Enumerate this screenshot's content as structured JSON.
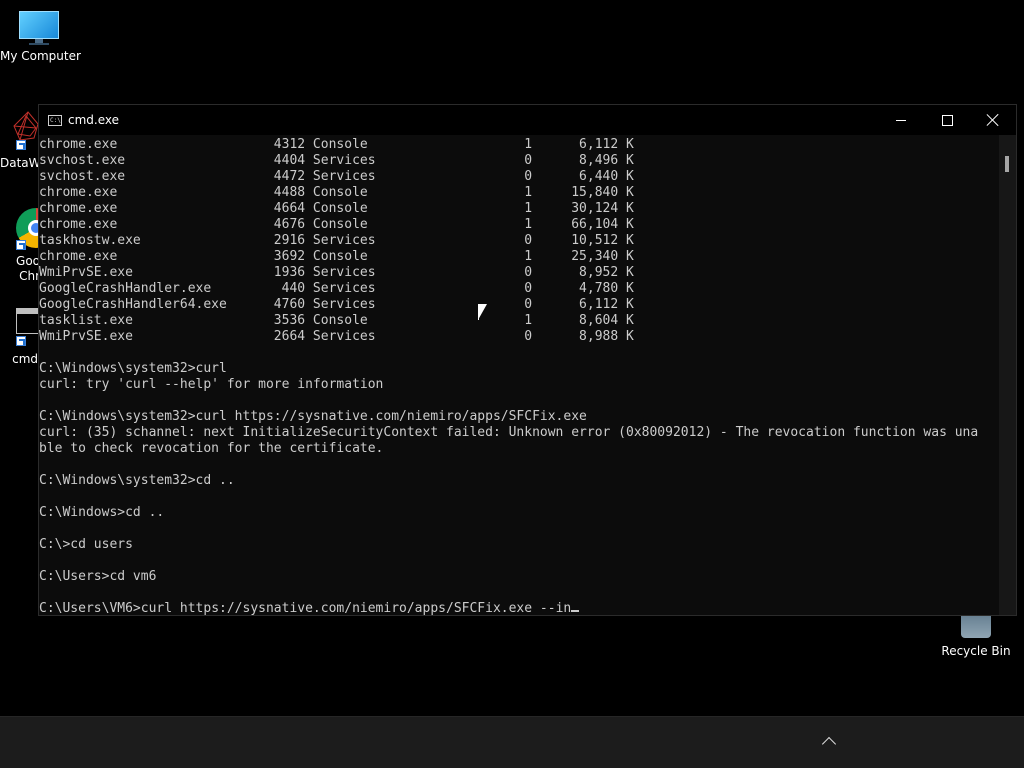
{
  "desktop": {
    "icons": [
      {
        "label": "My Computer",
        "icon": "monitor-icon"
      },
      {
        "label": "DataW",
        "icon": "datawrapper-shortcut-icon"
      },
      {
        "label": "Goo",
        "label2": "Chr",
        "icon": "chrome-shortcut-icon"
      },
      {
        "label": "cmd",
        "icon": "cmd-shortcut-icon"
      },
      {
        "label": "Recycle Bin",
        "icon": "recycle-bin-icon"
      }
    ]
  },
  "window": {
    "title": "cmd.exe",
    "app_icon_text": "C:\\",
    "controls": [
      "minimize",
      "maximize",
      "close"
    ]
  },
  "console": {
    "lines": [
      "chrome.exe                    4312 Console                    1      6,112 K",
      "svchost.exe                   4404 Services                   0      8,496 K",
      "svchost.exe                   4472 Services                   0      6,440 K",
      "chrome.exe                    4488 Console                    1     15,840 K",
      "chrome.exe                    4664 Console                    1     30,124 K",
      "chrome.exe                    4676 Console                    1     66,104 K",
      "taskhostw.exe                 2916 Services                   0     10,512 K",
      "chrome.exe                    3692 Console                    1     25,340 K",
      "WmiPrvSE.exe                  1936 Services                   0      8,952 K",
      "GoogleCrashHandler.exe         440 Services                   0      4,780 K",
      "GoogleCrashHandler64.exe      4760 Services                   0      6,112 K",
      "tasklist.exe                  3536 Console                    1      8,604 K",
      "WmiPrvSE.exe                  2664 Services                   0      8,988 K",
      "",
      "C:\\Windows\\system32>curl",
      "curl: try 'curl --help' for more information",
      "",
      "C:\\Windows\\system32>curl https://sysnative.com/niemiro/apps/SFCFix.exe",
      "curl: (35) schannel: next InitializeSecurityContext failed: Unknown error (0x80092012) - The revocation function was una",
      "ble to check revocation for the certificate.",
      "",
      "C:\\Windows\\system32>cd ..",
      "",
      "C:\\Windows>cd ..",
      "",
      "C:\\>cd users",
      "",
      "C:\\Users>cd vm6",
      ""
    ],
    "prompt": "C:\\Users\\VM6>",
    "input": "curl https://sysnative.com/niemiro/apps/SFCFix.exe --in"
  },
  "colors": {
    "console_bg": "#0c0c0c",
    "console_text": "#cccccc",
    "desktop_bg": "#000000",
    "taskbar_bg": "#1c1c1c"
  }
}
